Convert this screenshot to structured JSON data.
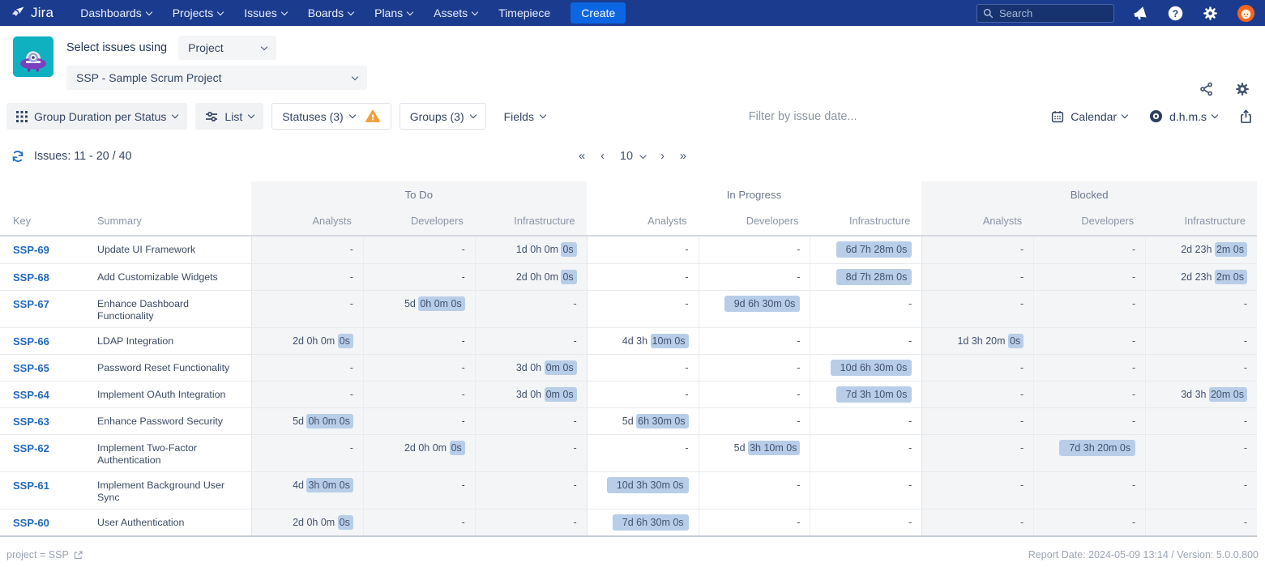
{
  "nav": {
    "brand": "Jira",
    "menu": [
      {
        "label": "Dashboards",
        "chevron": true
      },
      {
        "label": "Projects",
        "chevron": true
      },
      {
        "label": "Issues",
        "chevron": true
      },
      {
        "label": "Boards",
        "chevron": true
      },
      {
        "label": "Plans",
        "chevron": true
      },
      {
        "label": "Assets",
        "chevron": true
      },
      {
        "label": "Timepiece",
        "chevron": false
      }
    ],
    "create_label": "Create",
    "search_placeholder": "Search"
  },
  "header": {
    "select_issues_label": "Select issues using",
    "mode_value": "Project",
    "project_value": "SSP - Sample Scrum Project"
  },
  "toolbar": {
    "group_by_label": "Group Duration per Status",
    "view_label": "List",
    "statuses_label": "Statuses (3)",
    "groups_label": "Groups (3)",
    "fields_label": "Fields",
    "filter_placeholder": "Filter by issue date...",
    "calendar_label": "Calendar",
    "format_label": "d.h.m.s"
  },
  "issues_bar": {
    "label": "Issues: 11 - 20 / 40",
    "pagination": {
      "first": "«",
      "prev": "‹",
      "page_size": "10",
      "next": "›",
      "last": "»"
    }
  },
  "table": {
    "key_header": "Key",
    "summary_header": "Summary",
    "groups": [
      {
        "label": "To Do",
        "columns": [
          "Analysts",
          "Developers",
          "Infrastructure"
        ]
      },
      {
        "label": "In Progress",
        "columns": [
          "Analysts",
          "Developers",
          "Infrastructure"
        ]
      },
      {
        "label": "Blocked",
        "columns": [
          "Analysts",
          "Developers",
          "Infrastructure"
        ]
      }
    ],
    "rows": [
      {
        "key": "SSP-69",
        "summary": "Update UI Framework",
        "cells": [
          {
            "v": "-"
          },
          {
            "v": "-"
          },
          {
            "v": "1d 0h 0m 0s",
            "h": "0s"
          },
          {
            "v": "-"
          },
          {
            "v": "-"
          },
          {
            "v": "6d 7h 28m 0s",
            "h": "full"
          },
          {
            "v": "-"
          },
          {
            "v": "-"
          },
          {
            "v": "2d 23h 2m 0s",
            "h": "2m 0s"
          }
        ]
      },
      {
        "key": "SSP-68",
        "summary": "Add Customizable Widgets",
        "cells": [
          {
            "v": "-"
          },
          {
            "v": "-"
          },
          {
            "v": "2d 0h 0m 0s",
            "h": "0s"
          },
          {
            "v": "-"
          },
          {
            "v": "-"
          },
          {
            "v": "8d 7h 28m 0s",
            "h": "full"
          },
          {
            "v": "-"
          },
          {
            "v": "-"
          },
          {
            "v": "2d 23h 2m 0s",
            "h": "2m 0s"
          }
        ]
      },
      {
        "key": "SSP-67",
        "summary": "Enhance Dashboard Functionality",
        "cells": [
          {
            "v": "-"
          },
          {
            "v": "5d 0h 0m 0s",
            "h": "0h 0m 0s"
          },
          {
            "v": "-"
          },
          {
            "v": "-"
          },
          {
            "v": "9d 6h 30m 0s",
            "h": "full"
          },
          {
            "v": "-"
          },
          {
            "v": "-"
          },
          {
            "v": "-"
          },
          {
            "v": "-"
          }
        ]
      },
      {
        "key": "SSP-66",
        "summary": "LDAP Integration",
        "cells": [
          {
            "v": "2d 0h 0m 0s",
            "h": "0s"
          },
          {
            "v": "-"
          },
          {
            "v": "-"
          },
          {
            "v": "4d 3h 10m 0s",
            "h": "10m 0s"
          },
          {
            "v": "-"
          },
          {
            "v": "-"
          },
          {
            "v": "1d 3h 20m 0s",
            "h": "0s"
          },
          {
            "v": "-"
          },
          {
            "v": "-"
          }
        ]
      },
      {
        "key": "SSP-65",
        "summary": "Password Reset Functionality",
        "cells": [
          {
            "v": "-"
          },
          {
            "v": "-"
          },
          {
            "v": "3d 0h 0m 0s",
            "h": "0m 0s"
          },
          {
            "v": "-"
          },
          {
            "v": "-"
          },
          {
            "v": "10d 6h 30m 0s",
            "h": "full"
          },
          {
            "v": "-"
          },
          {
            "v": "-"
          },
          {
            "v": "-"
          }
        ]
      },
      {
        "key": "SSP-64",
        "summary": "Implement OAuth Integration",
        "cells": [
          {
            "v": "-"
          },
          {
            "v": "-"
          },
          {
            "v": "3d 0h 0m 0s",
            "h": "0m 0s"
          },
          {
            "v": "-"
          },
          {
            "v": "-"
          },
          {
            "v": "7d 3h 10m 0s",
            "h": "full"
          },
          {
            "v": "-"
          },
          {
            "v": "-"
          },
          {
            "v": "3d 3h 20m 0s",
            "h": "20m 0s"
          }
        ]
      },
      {
        "key": "SSP-63",
        "summary": "Enhance Password Security",
        "cells": [
          {
            "v": "5d 0h 0m 0s",
            "h": "0h 0m 0s"
          },
          {
            "v": "-"
          },
          {
            "v": "-"
          },
          {
            "v": "5d 6h 30m 0s",
            "h": "6h 30m 0s"
          },
          {
            "v": "-"
          },
          {
            "v": "-"
          },
          {
            "v": "-"
          },
          {
            "v": "-"
          },
          {
            "v": "-"
          }
        ]
      },
      {
        "key": "SSP-62",
        "summary": "Implement Two-Factor Authentication",
        "cells": [
          {
            "v": "-"
          },
          {
            "v": "2d 0h 0m 0s",
            "h": "0s"
          },
          {
            "v": "-"
          },
          {
            "v": "-"
          },
          {
            "v": "5d 3h 10m 0s",
            "h": "3h 10m 0s"
          },
          {
            "v": "-"
          },
          {
            "v": "-"
          },
          {
            "v": "7d 3h 20m 0s",
            "h": "full"
          },
          {
            "v": "-"
          }
        ]
      },
      {
        "key": "SSP-61",
        "summary": "Implement Background User Sync",
        "cells": [
          {
            "v": "4d 3h 0m 0s",
            "h": "3h 0m 0s"
          },
          {
            "v": "-"
          },
          {
            "v": "-"
          },
          {
            "v": "10d 3h 30m 0s",
            "h": "full"
          },
          {
            "v": "-"
          },
          {
            "v": "-"
          },
          {
            "v": "-"
          },
          {
            "v": "-"
          },
          {
            "v": "-"
          }
        ]
      },
      {
        "key": "SSP-60",
        "summary": "User Authentication",
        "cells": [
          {
            "v": "2d 0h 0m 0s",
            "h": "0s"
          },
          {
            "v": "-"
          },
          {
            "v": "-"
          },
          {
            "v": "7d 6h 30m 0s",
            "h": "full"
          },
          {
            "v": "-"
          },
          {
            "v": "-"
          },
          {
            "v": "-"
          },
          {
            "v": "-"
          },
          {
            "v": "-"
          }
        ]
      }
    ]
  },
  "footer": {
    "left": "project = SSP",
    "right": "Report Date: 2024-05-09 13:14 / Version: 5.0.0.800"
  },
  "colors": {
    "nav_bg": "#1B3B8E",
    "accent": "#0C66E4",
    "link": "#2268BC",
    "selection_highlight": "#B8CEE8",
    "warning": "#F0A03A",
    "group_band": "#F4F5F7",
    "logo_teal": "#0FB0C0",
    "logo_purple": "#7C3FBE",
    "avatar_orange": "#F2671C"
  }
}
